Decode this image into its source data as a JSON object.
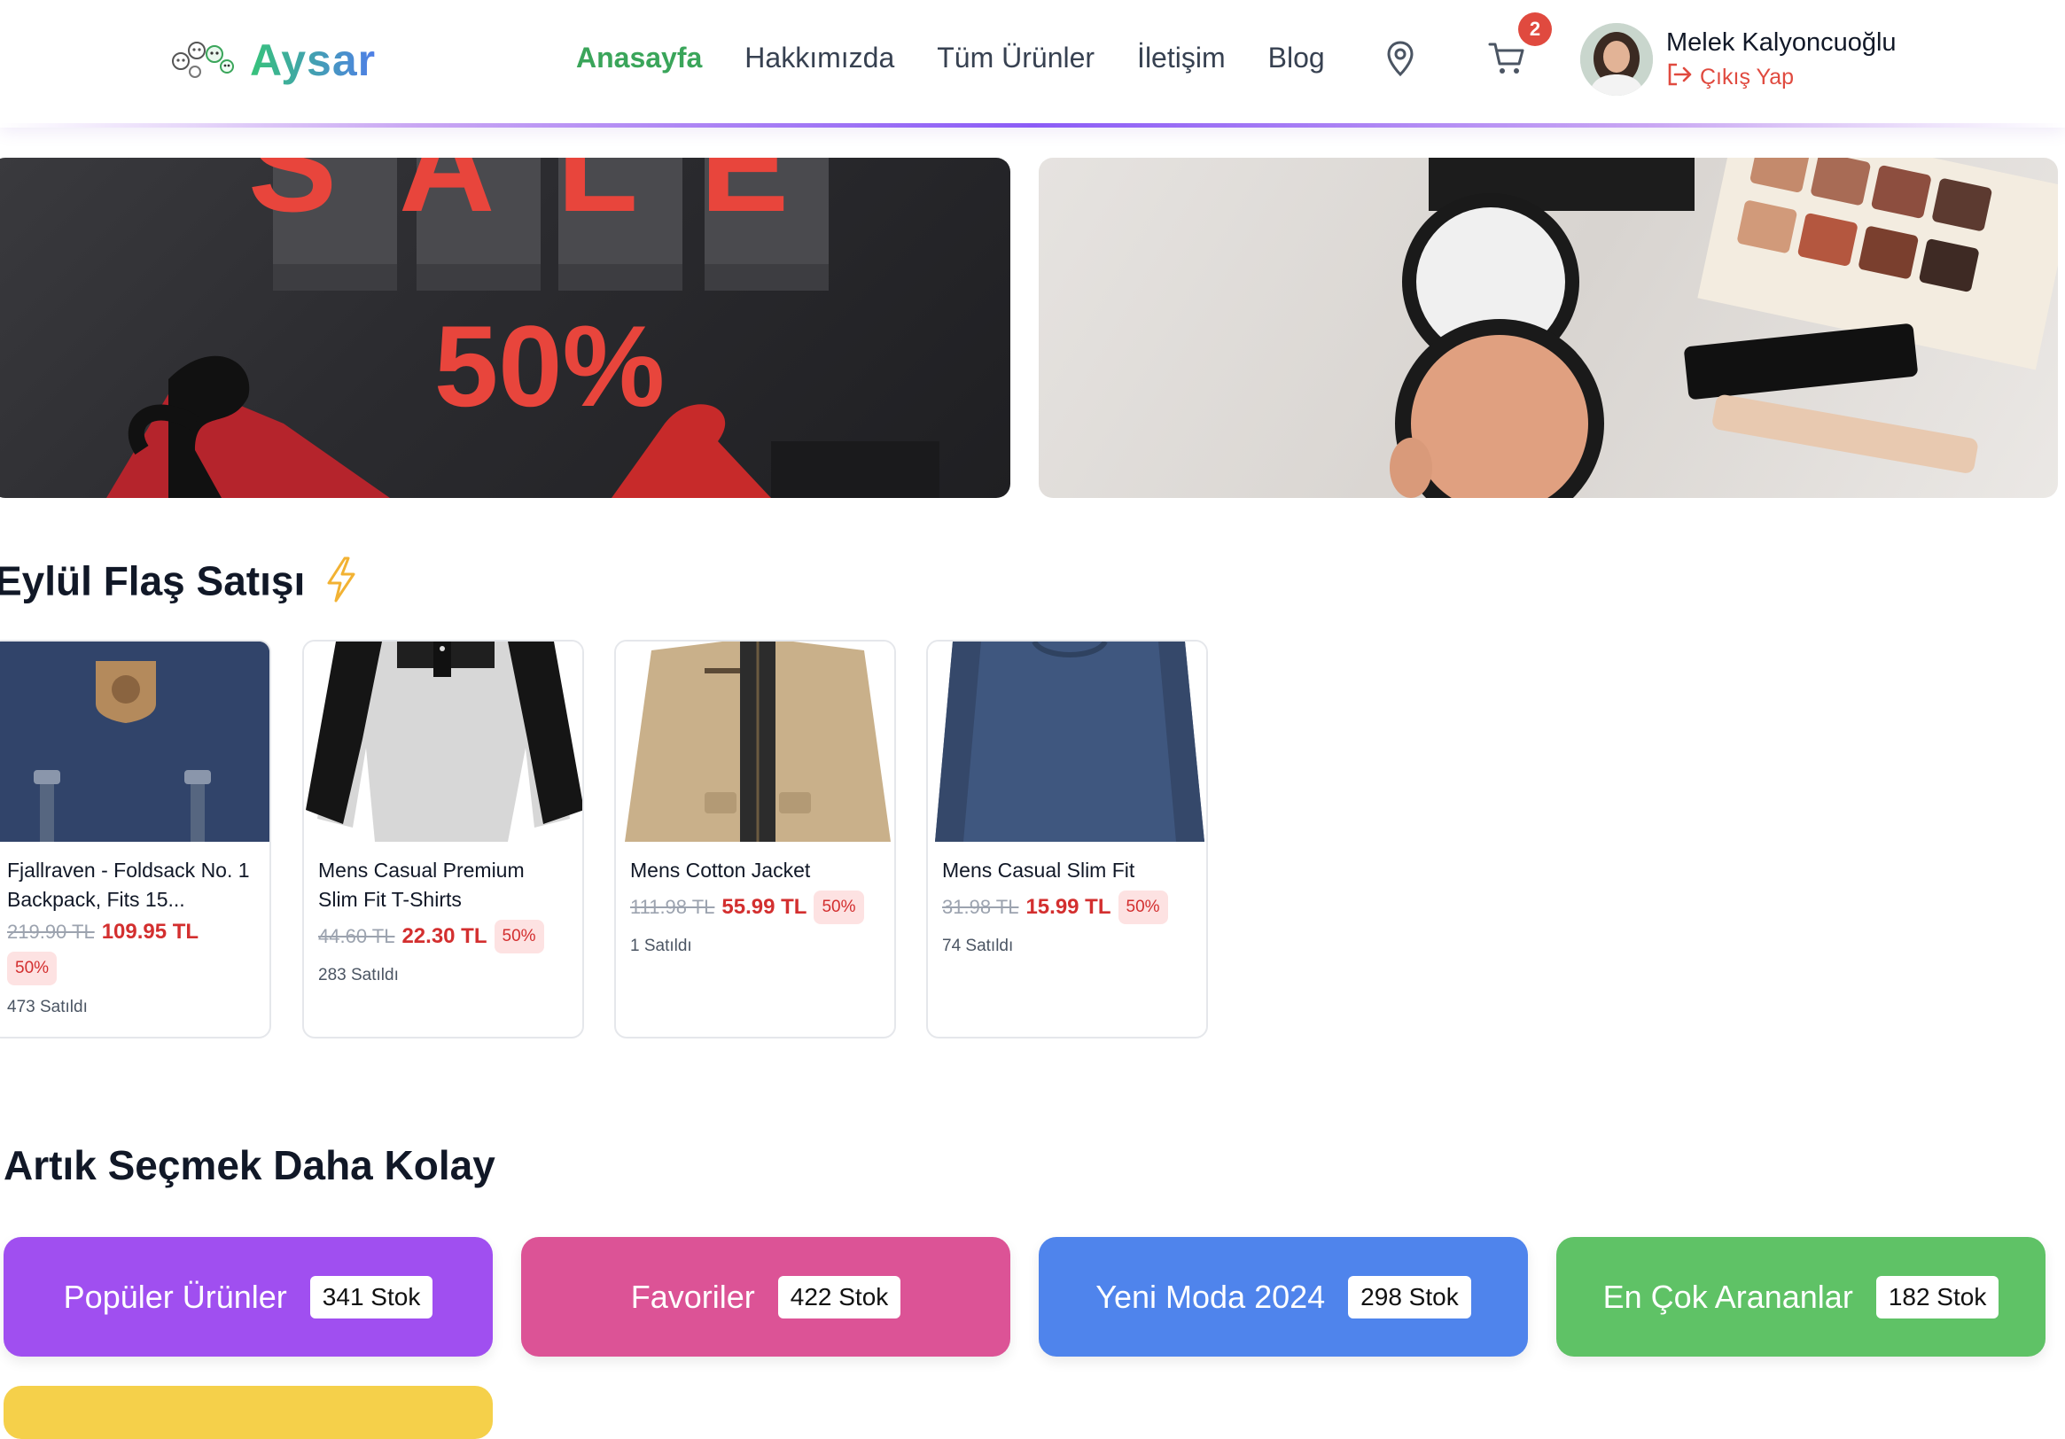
{
  "header": {
    "logo_text": "Aysar",
    "nav": [
      {
        "label": "Anasayfa",
        "active": true
      },
      {
        "label": "Hakkımızda",
        "active": false
      },
      {
        "label": "Tüm Ürünler",
        "active": false
      },
      {
        "label": "İletişim",
        "active": false
      },
      {
        "label": "Blog",
        "active": false
      }
    ],
    "cart_count": "2",
    "user_name": "Melek Kalyoncuoğlu",
    "logout_label": "Çıkış Yap"
  },
  "banners": {
    "sale_word": "SALE",
    "sale_percent": "50%"
  },
  "flash_sale": {
    "title": "Eylül Flaş Satışı",
    "products": [
      {
        "title": "Fjallraven - Foldsack No. 1 Backpack, Fits 15...",
        "old_price": "219.90 TL",
        "new_price": "109.95 TL",
        "discount": "50%",
        "sold": "473 Satıldı"
      },
      {
        "title": "Mens Casual Premium Slim Fit T-Shirts",
        "old_price": "44.60 TL",
        "new_price": "22.30 TL",
        "discount": "50%",
        "sold": "283 Satıldı"
      },
      {
        "title": "Mens Cotton Jacket",
        "old_price": "111.98 TL",
        "new_price": "55.99 TL",
        "discount": "50%",
        "sold": "1 Satıldı"
      },
      {
        "title": "Mens Casual Slim Fit",
        "old_price": "31.98 TL",
        "new_price": "15.99 TL",
        "discount": "50%",
        "sold": "74 Satıldı"
      }
    ]
  },
  "categories": {
    "title": "Artık Seçmek Daha Kolay",
    "items": [
      {
        "label": "Popüler Ürünler",
        "stock": "341 Stok",
        "color": "#a04ff0"
      },
      {
        "label": "Favoriler",
        "stock": "422 Stok",
        "color": "#dc5396"
      },
      {
        "label": "Yeni Moda 2024",
        "stock": "298 Stok",
        "color": "#4f84ec"
      },
      {
        "label": "En Çok Arananlar",
        "stock": "182 Stok",
        "color": "#5fc266"
      },
      {
        "label": "",
        "stock": "",
        "color": "#f5d04a"
      }
    ]
  },
  "colors": {
    "accent_green": "#3aa55a",
    "danger_red": "#d32f2f",
    "header_underline": "#8b5cf6"
  }
}
